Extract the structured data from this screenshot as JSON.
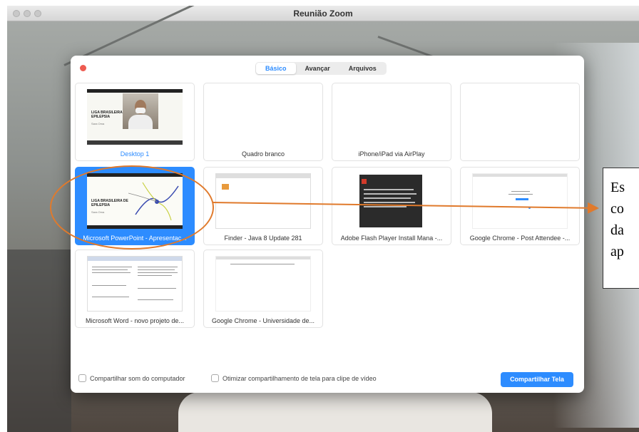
{
  "window": {
    "title": "Reunião Zoom"
  },
  "dialog": {
    "tabs": [
      {
        "label": "Básico",
        "active": true
      },
      {
        "label": "Avançar",
        "active": false
      },
      {
        "label": "Arquivos",
        "active": false
      }
    ],
    "tiles": [
      {
        "label": "Desktop 1",
        "state": "first",
        "thumb": "desktop",
        "slide_title_line1": "LIGA BRASILEIRA DE",
        "slide_title_line2": "EPILEPSIA",
        "slide_sub": "Sara Oma"
      },
      {
        "label": "Quadro branco",
        "thumb": "blank"
      },
      {
        "label": "iPhone/iPad via AirPlay",
        "thumb": "blank"
      },
      {
        "label": "",
        "thumb": "blank"
      },
      {
        "label": "Microsoft PowerPoint - Apresentaç...",
        "state": "selected",
        "thumb": "slide",
        "slide_title_line1": "LIGA BRASILEIRA DE",
        "slide_title_line2": "EPILEPSIA",
        "slide_sub": "Sara Oma"
      },
      {
        "label": "Finder - Java 8 Update 281",
        "thumb": "finder"
      },
      {
        "label": "Adobe Flash Player Install Mana -...",
        "thumb": "flash"
      },
      {
        "label": "Google Chrome - Post Attendee -...",
        "thumb": "chrome"
      },
      {
        "label": "Microsoft Word - novo projeto de...",
        "thumb": "word"
      },
      {
        "label": "Google Chrome - Universidade de...",
        "thumb": "chrome2"
      }
    ],
    "footer": {
      "share_sound_label": "Compartilhar som do computador",
      "optimize_video_label": "Otimizar compartilhamento de tela para clipe de vídeo",
      "share_button_label": "Compartilhar Tela"
    }
  },
  "annotation": {
    "callout_line1": "Es",
    "callout_line2": "co",
    "callout_line3": "da",
    "callout_line4": "ap",
    "color": "#e07a2c"
  },
  "colors": {
    "accent": "#2d8cff",
    "close": "#ee5b50"
  }
}
